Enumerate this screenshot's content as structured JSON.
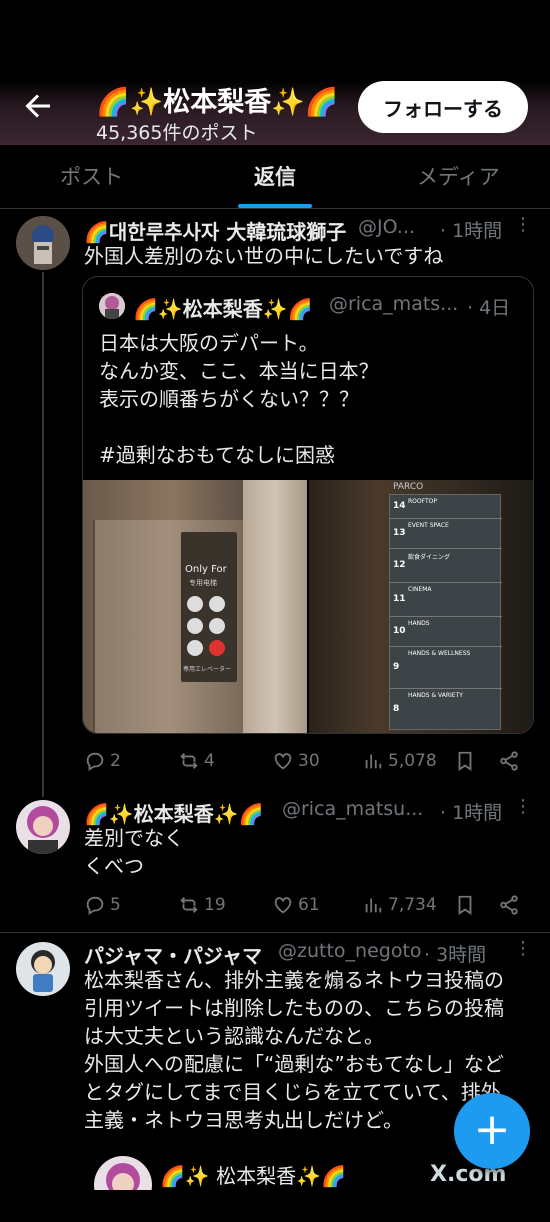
{
  "header": {
    "back_label": "",
    "title": "🌈✨松本梨香✨🌈",
    "post_count": "45,365件のポスト",
    "follow_label": "フォローする"
  },
  "tabs": [
    {
      "label": "ポスト"
    },
    {
      "label": "返信"
    },
    {
      "label": "メディア"
    }
  ],
  "reply1": {
    "name": "🌈대한루추사자 大韓琉球獅子",
    "handle": "@JO...",
    "time": "· 1時間",
    "text": "外国人差別のない世の中にしたいですね",
    "quote": {
      "name": "🌈✨松本梨香✨🌈",
      "handle": "@rica_mats...",
      "time": "· 4日",
      "text": "日本は大阪のデパート。\nなんか変、ここ、本当に日本？\n表示の順番ちがくない？？？\n\n#過剰なおもてなしに困惑",
      "elevator_sign": "Only For",
      "elevator_sign_sub": "专用电梯",
      "elevator_sign_jp": "専用エレベーター",
      "parco": "PARCO",
      "floors": [
        {
          "num": "14",
          "label": "ROOFTOP"
        },
        {
          "num": "13",
          "label": "EVENT SPACE"
        },
        {
          "num": "12",
          "label": "飲食ダイニング"
        },
        {
          "num": "11",
          "label": "CINEMA"
        },
        {
          "num": "10",
          "label": "HANDS"
        },
        {
          "num": "9",
          "label": "HANDS & WELLNESS"
        },
        {
          "num": "8",
          "label": "HANDS & VARIETY"
        }
      ]
    },
    "stats": {
      "replies": "2",
      "reposts": "4",
      "likes": "30",
      "views": "5,078"
    }
  },
  "reply2": {
    "name": "🌈✨松本梨香✨🌈",
    "handle": "@rica_matsu...",
    "time": "· 1時間",
    "text": "差別でなく\nくべつ",
    "stats": {
      "replies": "5",
      "reposts": "19",
      "likes": "61",
      "views": "7,734"
    }
  },
  "reply3": {
    "name": "パジャマ・パジャマ",
    "handle": "@zutto_negoto",
    "time": "· 3時間",
    "text": "松本梨香さん、排外主義を煽るネトウヨ投稿の\n引用ツイートは削除したものの、こちらの投稿\nは大丈夫という認識なんだなと。\n外国人への配慮に「“過剰な”おもてなし」など\nとタグにしてまで目くじらを立てていて、排外\n主義・ネトウヨ思考丸出しだけど。",
    "embed_name": "🌈✨ 松本梨香✨🌈"
  },
  "fab_label": "+",
  "watermark": "X.com",
  "colors": {
    "accent": "#1d9bf0",
    "muted": "#71767b",
    "text": "#e7e9ea",
    "border": "#2f3336"
  }
}
